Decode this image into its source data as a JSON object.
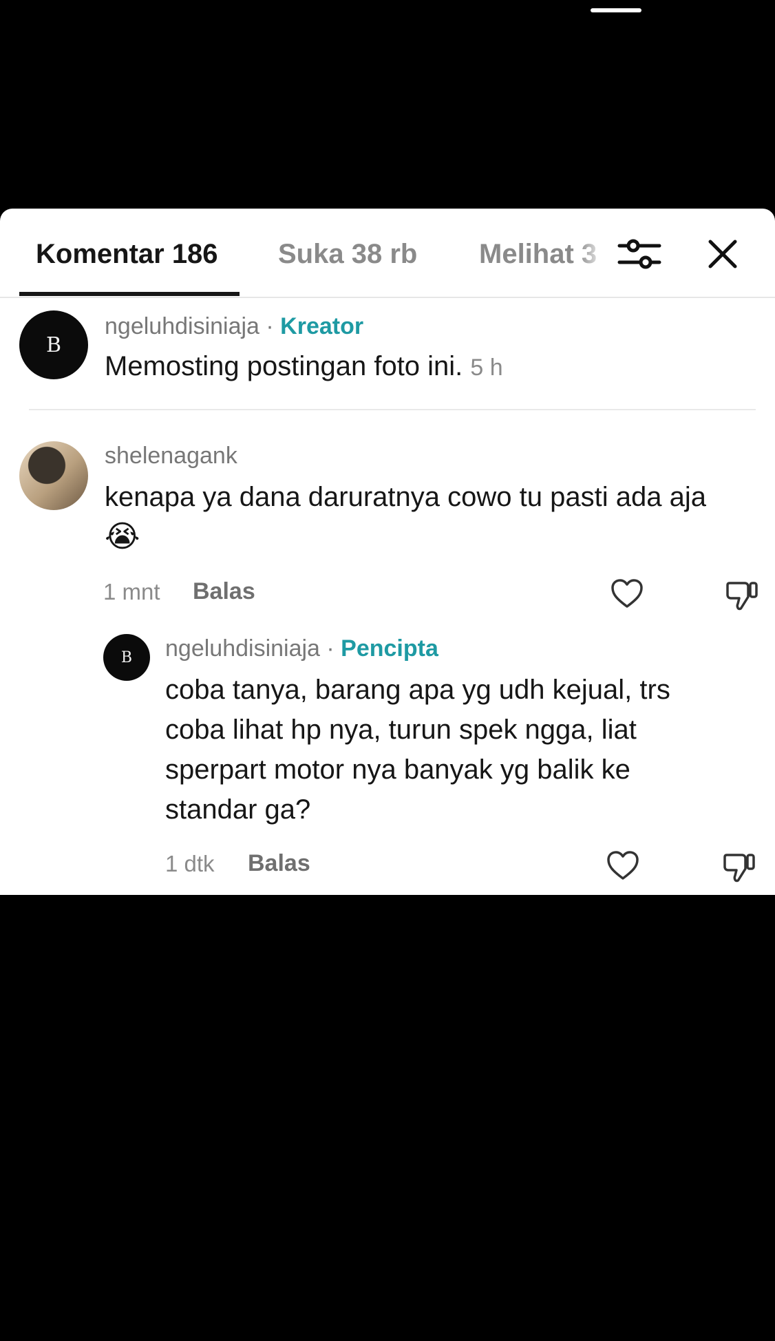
{
  "tabs": [
    {
      "label": "Komentar 186"
    },
    {
      "label": "Suka 38 rb"
    },
    {
      "label": "Melihat 3"
    }
  ],
  "icons": {
    "filter": "sliders-icon",
    "close": "close-icon",
    "like": "heart-outline-icon",
    "dislike": "thumbs-down-icon"
  },
  "colors": {
    "creator_tag": "#1e9aa3",
    "active_tab": "#161616",
    "inactive_tab": "#8a8a8a"
  },
  "comments": [
    {
      "username": "ngeluhdisiniaja",
      "separator": " · ",
      "tag": "Kreator",
      "text": "Memosting postingan foto ini.",
      "time": "5 h",
      "avatar_letter": "B"
    },
    {
      "username": "shelenagank",
      "text": "kenapa ya dana daruratnya cowo tu pasti ada aja",
      "emoji": "😭",
      "time": "1 mnt",
      "reply_label": "Balas"
    },
    {
      "username": "ngeluhdisiniaja",
      "separator": " · ",
      "tag": "Pencipta",
      "lines": [
        "coba tanya, barang apa yg udh kejual, trs",
        "coba lihat hp nya, turun spek ngga, liat",
        "sperpart motor nya banyak yg balik ke",
        "standar ga?"
      ],
      "time": "1 dtk",
      "reply_label": "Balas",
      "avatar_letter": "B"
    }
  ]
}
